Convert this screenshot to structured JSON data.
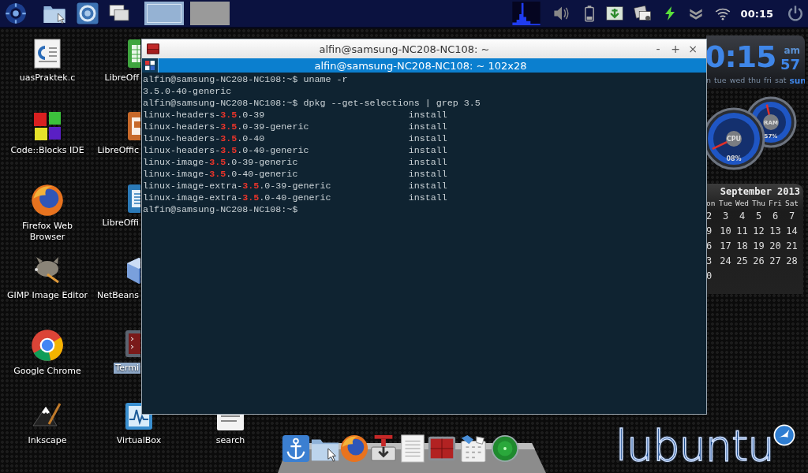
{
  "panel": {
    "workspaces": [
      {
        "selected": true
      },
      {
        "selected": false
      }
    ],
    "clock": "00:15"
  },
  "desktop": {
    "columns": [
      [
        {
          "label": "uasPraktek.c",
          "selected": false
        },
        {
          "label": "Code::Blocks IDE",
          "selected": false
        },
        {
          "label": "Firefox Web Browser",
          "selected": false
        },
        {
          "label": "GIMP Image Editor",
          "selected": false
        },
        {
          "label": "Google Chrome",
          "selected": false
        },
        {
          "label": "Inkscape",
          "selected": false
        }
      ],
      [
        {
          "label": "LibreOff",
          "selected": false
        },
        {
          "label": "LibreOffic",
          "selected": false
        },
        {
          "label": "LibreOffi",
          "selected": false
        },
        {
          "label": "NetBeans",
          "selected": false
        },
        {
          "label": "Termi",
          "selected": true
        },
        {
          "label": "VirtualBox",
          "selected": false
        }
      ],
      [
        {
          "label": "search",
          "selected": false
        }
      ]
    ]
  },
  "terminal": {
    "title": "alfin@samsung-NC208-NC108: ~",
    "buttons": [
      "-",
      "+",
      "×"
    ],
    "tab": "alfin@samsung-NC208-NC108: ~ 102x28",
    "lines": [
      {
        "kind": "text",
        "text": "alfin@samsung-NC208-NC108:~$ uname -r"
      },
      {
        "kind": "text",
        "text": "3.5.0-40-generic"
      },
      {
        "kind": "text",
        "text": "alfin@samsung-NC208-NC108:~$ dpkg --get-selections | grep 3.5"
      },
      {
        "kind": "package",
        "name": "linux-headers-**3.5**.0-39",
        "status": "install"
      },
      {
        "kind": "package",
        "name": "linux-headers-**3.5**.0-39-generic",
        "status": "install"
      },
      {
        "kind": "package",
        "name": "linux-headers-**3.5**.0-40",
        "status": "install"
      },
      {
        "kind": "package",
        "name": "linux-headers-**3.5**.0-40-generic",
        "status": "install"
      },
      {
        "kind": "package",
        "name": "linux-image-**3.5**.0-39-generic",
        "status": "install"
      },
      {
        "kind": "package",
        "name": "linux-image-**3.5**.0-40-generic",
        "status": "install"
      },
      {
        "kind": "package",
        "name": "linux-image-extra-**3.5**.0-39-generic",
        "status": "install"
      },
      {
        "kind": "package",
        "name": "linux-image-extra-**3.5**.0-40-generic",
        "status": "install"
      },
      {
        "kind": "text",
        "text": "alfin@samsung-NC208-NC108:~$"
      }
    ]
  },
  "clock_widget": {
    "time": "0:15",
    "seconds": "57",
    "meridiem": "am",
    "days": [
      {
        "label": "n",
        "selected": false
      },
      {
        "label": "tue",
        "selected": false
      },
      {
        "label": "wed",
        "selected": false
      },
      {
        "label": "thu",
        "selected": false
      },
      {
        "label": "fri",
        "selected": false
      },
      {
        "label": "sat",
        "selected": false
      },
      {
        "label": "sun",
        "selected": true
      }
    ]
  },
  "gauges": [
    {
      "label": "CPU",
      "reading": "08%"
    },
    {
      "label": "RAM",
      "reading": "57%"
    }
  ],
  "calendar": {
    "title": "September 2013",
    "weekdays": [
      "on",
      "Tue",
      "Wed",
      "Thu",
      "Fri",
      "Sat"
    ],
    "weeks": [
      [
        "2",
        "3",
        "4",
        "5",
        "6",
        "7"
      ],
      [
        "9",
        "10",
        "11",
        "12",
        "13",
        "14"
      ],
      [
        "6",
        "17",
        "18",
        "19",
        "20",
        "21"
      ],
      [
        "3",
        "24",
        "25",
        "26",
        "27",
        "28"
      ],
      [
        "0"
      ]
    ]
  },
  "logo": "lubuntu"
}
